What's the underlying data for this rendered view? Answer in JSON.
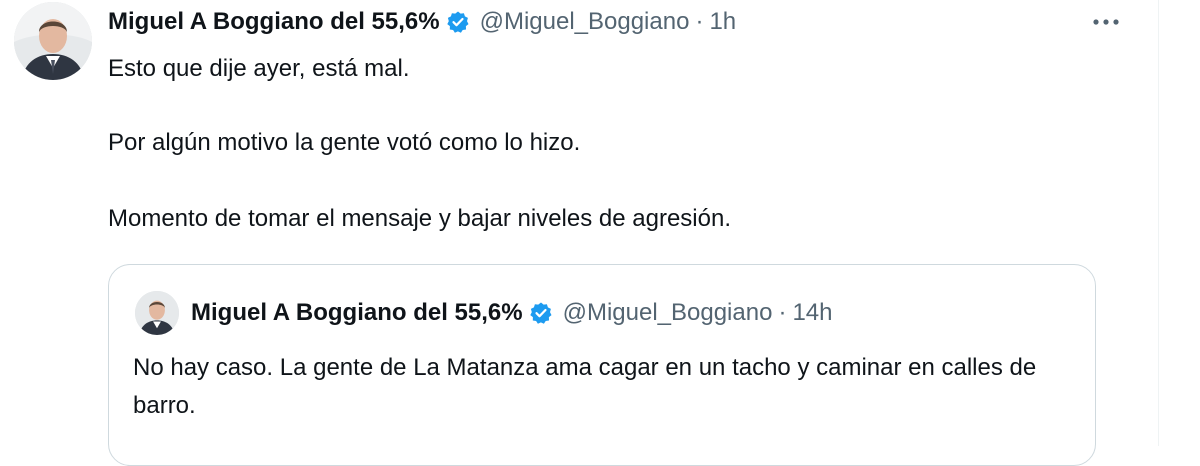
{
  "tweet": {
    "author_name": "Miguel A Boggiano del 55,6%",
    "handle": "@Miguel_Boggiano",
    "separator": "·",
    "time": "1h",
    "paragraphs": [
      "Esto que dije ayer, está mal.",
      "Por algún motivo la gente votó como lo hizo.",
      "Momento de tomar el mensaje y bajar niveles de agresión."
    ]
  },
  "quoted_tweet": {
    "author_name": "Miguel A Boggiano del 55,6%",
    "handle": "@Miguel_Boggiano",
    "separator": "·",
    "time": "14h",
    "text": "No hay caso. La gente de La Matanza ama cagar en un tacho y caminar en calles de barro."
  },
  "icons": {
    "verified": "verified-badge-icon",
    "more": "more-options-icon"
  },
  "colors": {
    "verified_blue": "#1d9bf0",
    "secondary_text": "#536471",
    "border": "#cfd9de"
  }
}
